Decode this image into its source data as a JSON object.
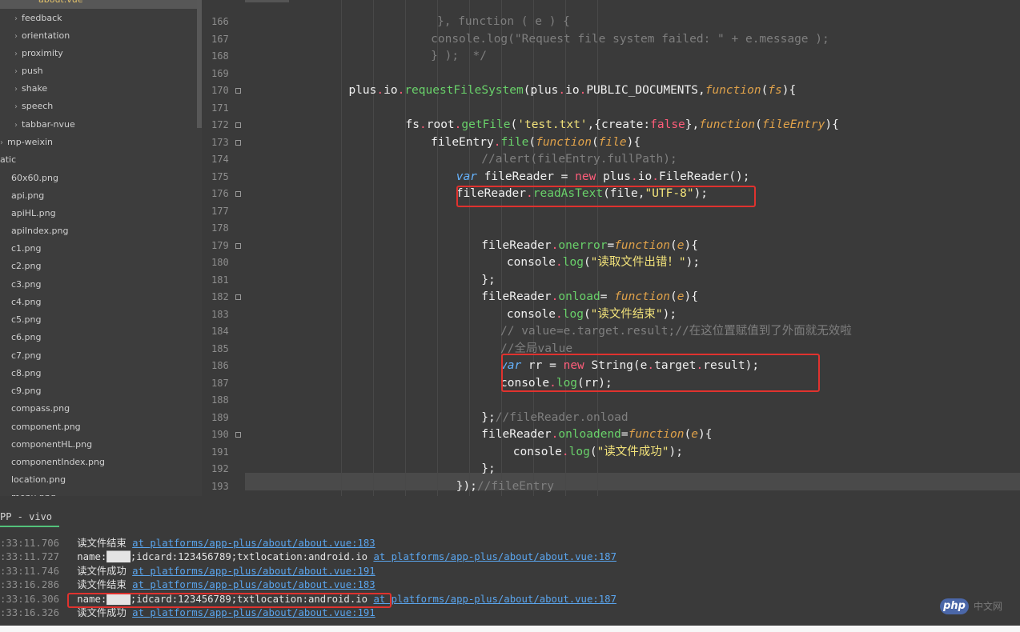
{
  "sidebar": {
    "items": [
      {
        "label": "about.vue",
        "chevron": "",
        "active": true
      },
      {
        "label": "feedback",
        "chevron": "›"
      },
      {
        "label": "orientation",
        "chevron": "›"
      },
      {
        "label": "proximity",
        "chevron": "›"
      },
      {
        "label": "push",
        "chevron": "›"
      },
      {
        "label": "shake",
        "chevron": "›"
      },
      {
        "label": "speech",
        "chevron": "›"
      },
      {
        "label": "tabbar-nvue",
        "chevron": "›"
      },
      {
        "label": "mp-weixin",
        "chevron": "›"
      },
      {
        "label": "atic",
        "chevron": ""
      },
      {
        "label": "60x60.png",
        "chevron": ""
      },
      {
        "label": "api.png",
        "chevron": ""
      },
      {
        "label": "apiHL.png",
        "chevron": ""
      },
      {
        "label": "apiIndex.png",
        "chevron": ""
      },
      {
        "label": "c1.png",
        "chevron": ""
      },
      {
        "label": "c2.png",
        "chevron": ""
      },
      {
        "label": "c3.png",
        "chevron": ""
      },
      {
        "label": "c4.png",
        "chevron": ""
      },
      {
        "label": "c5.png",
        "chevron": ""
      },
      {
        "label": "c6.png",
        "chevron": ""
      },
      {
        "label": "c7.png",
        "chevron": ""
      },
      {
        "label": "c8.png",
        "chevron": ""
      },
      {
        "label": "c9.png",
        "chevron": ""
      },
      {
        "label": "compass.png",
        "chevron": ""
      },
      {
        "label": "component.png",
        "chevron": ""
      },
      {
        "label": "componentHL.png",
        "chevron": ""
      },
      {
        "label": "componentIndex.png",
        "chevron": ""
      },
      {
        "label": "location.png",
        "chevron": ""
      },
      {
        "label": "menu.png",
        "chevron": ""
      }
    ]
  },
  "editor": {
    "lines": [
      {
        "num": "166",
        "fold": false
      },
      {
        "num": "167",
        "fold": false
      },
      {
        "num": "168",
        "fold": false
      },
      {
        "num": "169",
        "fold": false
      },
      {
        "num": "170",
        "fold": true
      },
      {
        "num": "171",
        "fold": false
      },
      {
        "num": "172",
        "fold": true
      },
      {
        "num": "173",
        "fold": true
      },
      {
        "num": "174",
        "fold": false
      },
      {
        "num": "175",
        "fold": false
      },
      {
        "num": "176",
        "fold": true
      },
      {
        "num": "177",
        "fold": false
      },
      {
        "num": "178",
        "fold": false
      },
      {
        "num": "179",
        "fold": true
      },
      {
        "num": "180",
        "fold": false
      },
      {
        "num": "181",
        "fold": false
      },
      {
        "num": "182",
        "fold": true
      },
      {
        "num": "183",
        "fold": false
      },
      {
        "num": "184",
        "fold": false
      },
      {
        "num": "185",
        "fold": false
      },
      {
        "num": "186",
        "fold": false
      },
      {
        "num": "187",
        "fold": false
      },
      {
        "num": "188",
        "fold": false
      },
      {
        "num": "189",
        "fold": false
      },
      {
        "num": "190",
        "fold": true
      },
      {
        "num": "191",
        "fold": false
      },
      {
        "num": "192",
        "fold": false
      },
      {
        "num": "193",
        "fold": false
      }
    ],
    "code": [
      {
        "indent": 29,
        "tokens": [
          {
            "t": "}, function ( e ) {",
            "c": "dim"
          }
        ]
      },
      {
        "indent": 28,
        "tokens": [
          {
            "t": "console.log(\"Request file system failed: \" + e.message );",
            "c": "dim"
          }
        ]
      },
      {
        "indent": 28,
        "tokens": [
          {
            "t": "} );  */",
            "c": "dim"
          }
        ]
      },
      {
        "indent": 0,
        "tokens": []
      },
      {
        "indent": 15,
        "tokens": [
          {
            "t": "plus",
            "c": ""
          },
          {
            "t": ".",
            "c": "dot"
          },
          {
            "t": "io",
            "c": ""
          },
          {
            "t": ".",
            "c": "dot"
          },
          {
            "t": "requestFileSystem",
            "c": "met"
          },
          {
            "t": "(plus",
            "c": ""
          },
          {
            "t": ".",
            "c": "dot"
          },
          {
            "t": "io",
            "c": ""
          },
          {
            "t": ".",
            "c": "dot"
          },
          {
            "t": "PUBLIC_DOCUMENTS,",
            "c": ""
          },
          {
            "t": "function",
            "c": "fn"
          },
          {
            "t": "(",
            "c": ""
          },
          {
            "t": "fs",
            "c": "param"
          },
          {
            "t": "){",
            "c": ""
          }
        ]
      },
      {
        "indent": 0,
        "tokens": []
      },
      {
        "indent": 24,
        "tokens": [
          {
            "t": "fs",
            "c": ""
          },
          {
            "t": ".",
            "c": "dot"
          },
          {
            "t": "root",
            "c": ""
          },
          {
            "t": ".",
            "c": "dot"
          },
          {
            "t": "getFile",
            "c": "met"
          },
          {
            "t": "(",
            "c": ""
          },
          {
            "t": "'test.txt'",
            "c": "str"
          },
          {
            "t": ",{create:",
            "c": ""
          },
          {
            "t": "false",
            "c": "kw"
          },
          {
            "t": "},",
            "c": ""
          },
          {
            "t": "function",
            "c": "fn"
          },
          {
            "t": "(",
            "c": ""
          },
          {
            "t": "fileEntry",
            "c": "param"
          },
          {
            "t": "){",
            "c": ""
          }
        ]
      },
      {
        "indent": 28,
        "tokens": [
          {
            "t": "fileEntry",
            "c": ""
          },
          {
            "t": ".",
            "c": "dot"
          },
          {
            "t": "file",
            "c": "met"
          },
          {
            "t": "(",
            "c": ""
          },
          {
            "t": "function",
            "c": "fn"
          },
          {
            "t": "(",
            "c": ""
          },
          {
            "t": "file",
            "c": "param"
          },
          {
            "t": "){",
            "c": ""
          }
        ]
      },
      {
        "indent": 36,
        "tokens": [
          {
            "t": "//alert(fileEntry.fullPath);",
            "c": "cmt"
          }
        ]
      },
      {
        "indent": 32,
        "tokens": [
          {
            "t": "var",
            "c": "var"
          },
          {
            "t": " fileReader = ",
            "c": ""
          },
          {
            "t": "new",
            "c": "kw"
          },
          {
            "t": " plus",
            "c": ""
          },
          {
            "t": ".",
            "c": "dot"
          },
          {
            "t": "io",
            "c": ""
          },
          {
            "t": ".",
            "c": "dot"
          },
          {
            "t": "FileReader();",
            "c": ""
          }
        ]
      },
      {
        "indent": 32,
        "tokens": [
          {
            "t": "fileReader",
            "c": ""
          },
          {
            "t": ".",
            "c": "dot"
          },
          {
            "t": "readAsText",
            "c": "met"
          },
          {
            "t": "(file,",
            "c": ""
          },
          {
            "t": "\"UTF-8\"",
            "c": "str"
          },
          {
            "t": ");",
            "c": ""
          }
        ]
      },
      {
        "indent": 0,
        "tokens": []
      },
      {
        "indent": 0,
        "tokens": []
      },
      {
        "indent": 36,
        "tokens": [
          {
            "t": "fileReader",
            "c": ""
          },
          {
            "t": ".",
            "c": "dot"
          },
          {
            "t": "onerror",
            "c": "met"
          },
          {
            "t": "=",
            "c": ""
          },
          {
            "t": "function",
            "c": "fn"
          },
          {
            "t": "(",
            "c": ""
          },
          {
            "t": "e",
            "c": "param"
          },
          {
            "t": "){",
            "c": ""
          }
        ]
      },
      {
        "indent": 40,
        "tokens": [
          {
            "t": "console",
            "c": ""
          },
          {
            "t": ".",
            "c": "dot"
          },
          {
            "t": "log",
            "c": "met"
          },
          {
            "t": "(",
            "c": ""
          },
          {
            "t": "\"读取文件出错！\"",
            "c": "str"
          },
          {
            "t": ");",
            "c": ""
          }
        ]
      },
      {
        "indent": 36,
        "tokens": [
          {
            "t": "};",
            "c": ""
          }
        ]
      },
      {
        "indent": 36,
        "tokens": [
          {
            "t": "fileReader",
            "c": ""
          },
          {
            "t": ".",
            "c": "dot"
          },
          {
            "t": "onload",
            "c": "met"
          },
          {
            "t": "= ",
            "c": ""
          },
          {
            "t": "function",
            "c": "fn"
          },
          {
            "t": "(",
            "c": ""
          },
          {
            "t": "e",
            "c": "param"
          },
          {
            "t": "){",
            "c": ""
          }
        ]
      },
      {
        "indent": 40,
        "tokens": [
          {
            "t": "console",
            "c": ""
          },
          {
            "t": ".",
            "c": "dot"
          },
          {
            "t": "log",
            "c": "met"
          },
          {
            "t": "(",
            "c": ""
          },
          {
            "t": "\"读文件结束\"",
            "c": "str"
          },
          {
            "t": ");",
            "c": ""
          }
        ]
      },
      {
        "indent": 39,
        "tokens": [
          {
            "t": "// value=e.target.result;//在这位置赋值到了外面就无效啦",
            "c": "cmt"
          }
        ]
      },
      {
        "indent": 39,
        "tokens": [
          {
            "t": "//全局value",
            "c": "cmt"
          }
        ]
      },
      {
        "indent": 39,
        "tokens": [
          {
            "t": "var",
            "c": "var"
          },
          {
            "t": " rr = ",
            "c": ""
          },
          {
            "t": "new",
            "c": "kw"
          },
          {
            "t": " String(e",
            "c": ""
          },
          {
            "t": ".",
            "c": "dot"
          },
          {
            "t": "target",
            "c": ""
          },
          {
            "t": ".",
            "c": "dot"
          },
          {
            "t": "result);",
            "c": ""
          }
        ]
      },
      {
        "indent": 39,
        "tokens": [
          {
            "t": "console",
            "c": ""
          },
          {
            "t": ".",
            "c": "dot"
          },
          {
            "t": "log",
            "c": "met"
          },
          {
            "t": "(rr);",
            "c": ""
          }
        ]
      },
      {
        "indent": 0,
        "tokens": []
      },
      {
        "indent": 36,
        "tokens": [
          {
            "t": "};",
            "c": ""
          },
          {
            "t": "//fileReader.onload",
            "c": "cmt"
          }
        ]
      },
      {
        "indent": 36,
        "tokens": [
          {
            "t": "fileReader",
            "c": ""
          },
          {
            "t": ".",
            "c": "dot"
          },
          {
            "t": "onloadend",
            "c": "met"
          },
          {
            "t": "=",
            "c": ""
          },
          {
            "t": "function",
            "c": "fn"
          },
          {
            "t": "(",
            "c": ""
          },
          {
            "t": "e",
            "c": "param"
          },
          {
            "t": "){",
            "c": ""
          }
        ]
      },
      {
        "indent": 41,
        "tokens": [
          {
            "t": "console",
            "c": ""
          },
          {
            "t": ".",
            "c": "dot"
          },
          {
            "t": "log",
            "c": "met"
          },
          {
            "t": "(",
            "c": ""
          },
          {
            "t": "\"读文件成功\"",
            "c": "str"
          },
          {
            "t": ");",
            "c": ""
          }
        ]
      },
      {
        "indent": 36,
        "tokens": [
          {
            "t": "};",
            "c": ""
          }
        ]
      },
      {
        "indent": 32,
        "tokens": [
          {
            "t": "});",
            "c": ""
          },
          {
            "t": "//fileEntry",
            "c": "cmt"
          }
        ]
      }
    ]
  },
  "console": {
    "tab_label": "PP - vivo",
    "logs": [
      {
        "time": ":33:11.706",
        "msg": "读文件结束",
        "link": "at platforms/app-plus/about/about.vue:183"
      },
      {
        "time": ":33:11.727",
        "msg": "name:████;idcard:123456789;txtlocation:android.io",
        "link": "at platforms/app-plus/about/about.vue:187"
      },
      {
        "time": ":33:11.746",
        "msg": "读文件成功",
        "link": "at platforms/app-plus/about/about.vue:191"
      },
      {
        "time": ":33:16.286",
        "msg": "读文件结束",
        "link": "at platforms/app-plus/about/about.vue:183"
      },
      {
        "time": ":33:16.306",
        "msg": "name:████;idcard:123456789;txtlocation:android.io",
        "link": "at platforms/app-plus/about/about.vue:187"
      },
      {
        "time": ":33:16.326",
        "msg": "读文件成功",
        "link": "at platforms/app-plus/about/about.vue:191"
      }
    ]
  },
  "watermark": {
    "badge": "php",
    "text": "中文网"
  },
  "colors": {
    "highlight_box": "#e0322e",
    "link": "#5aa5ee",
    "console_tab_underline": "#53c27b"
  }
}
